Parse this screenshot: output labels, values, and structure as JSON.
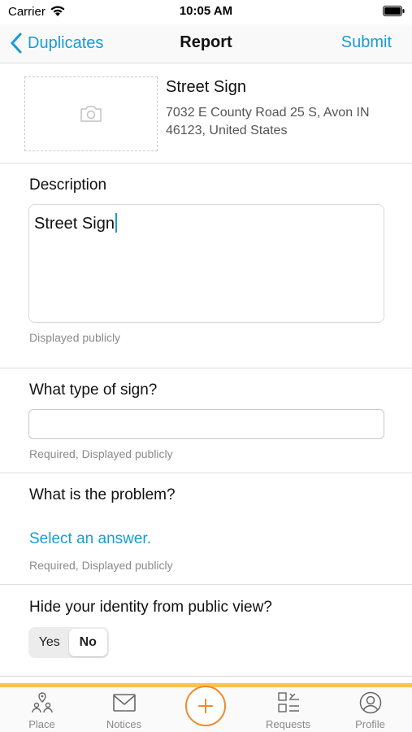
{
  "status_bar": {
    "carrier": "Carrier",
    "time": "10:05 AM"
  },
  "nav": {
    "back_label": "Duplicates",
    "title": "Report",
    "submit_label": "Submit"
  },
  "location": {
    "name": "Street Sign",
    "address": "7032 E County Road 25 S, Avon IN 46123, United States",
    "photo_icon": "camera-icon"
  },
  "description": {
    "label": "Description",
    "value": "Street Sign",
    "helper": "Displayed publicly"
  },
  "sign_type": {
    "label": "What type of sign?",
    "value": "",
    "helper": "Required, Displayed publicly"
  },
  "problem": {
    "label": "What is the problem?",
    "select_label": "Select an answer.",
    "helper": "Required, Displayed publicly"
  },
  "identity": {
    "label": "Hide your identity from public view?",
    "options": [
      "Yes",
      "No"
    ],
    "selected": "No"
  },
  "tabs": {
    "place": "Place",
    "notices": "Notices",
    "requests": "Requests",
    "profile": "Profile"
  },
  "colors": {
    "accent": "#1a9bd7",
    "tab_accent": "#f8c44a",
    "add_button": "#f0892a"
  }
}
